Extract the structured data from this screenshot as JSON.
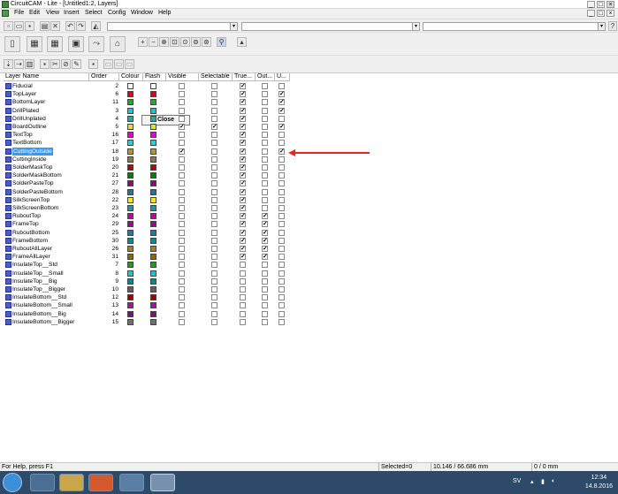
{
  "window": {
    "title": "CircuitCAM - Lite - [Untitled1:2, Layers]",
    "min": "_",
    "max": "□",
    "close": "×",
    "doc_min": "_",
    "doc_max": "□",
    "doc_close": "×"
  },
  "menu": [
    "File",
    "Edit",
    "View",
    "Insert",
    "Select",
    "Config",
    "Window",
    "Help"
  ],
  "toolbar": {
    "unit_value": "mm",
    "close_label": "Close",
    "help_icon": "?"
  },
  "columns": [
    "Layer Name",
    "Order",
    "Colour",
    "Flash",
    "Visible",
    "Selectable",
    "True...",
    "Out...",
    "U..."
  ],
  "layers": [
    {
      "name": "Fiducial",
      "order": "2",
      "colour": "#ffffff",
      "flash": "#ffffff",
      "visible": false,
      "selectable": false,
      "true": true,
      "out": false,
      "u": false
    },
    {
      "name": "TopLayer",
      "order": "6",
      "colour": "#e0001a",
      "flash": "#e0001a",
      "visible": false,
      "selectable": false,
      "true": true,
      "out": false,
      "u": true
    },
    {
      "name": "BottomLayer",
      "order": "11",
      "colour": "#00c000",
      "flash": "#00c000",
      "visible": false,
      "selectable": false,
      "true": true,
      "out": false,
      "u": true
    },
    {
      "name": "DrillPlated",
      "order": "3",
      "colour": "#00d0d0",
      "flash": "#00d0d0",
      "visible": false,
      "selectable": false,
      "true": true,
      "out": false,
      "u": true
    },
    {
      "name": "DrillUnplated",
      "order": "4",
      "colour": "#2aa8a0",
      "flash": "#2aa8a0",
      "visible": false,
      "selectable": false,
      "true": true,
      "out": false,
      "u": false
    },
    {
      "name": "BoardOutline",
      "order": "5",
      "colour": "#e6e600",
      "flash": "#e6e600",
      "visible": true,
      "selectable": true,
      "true": true,
      "out": false,
      "u": true
    },
    {
      "name": "TextTop",
      "order": "16",
      "colour": "#e000e0",
      "flash": "#e000e0",
      "visible": false,
      "selectable": false,
      "true": true,
      "out": false,
      "u": false
    },
    {
      "name": "TextBottom",
      "order": "17",
      "colour": "#00e0e0",
      "flash": "#00e0e0",
      "visible": false,
      "selectable": false,
      "true": true,
      "out": false,
      "u": false
    },
    {
      "name": "CuttingOutside",
      "order": "18",
      "colour": "#b0a000",
      "flash": "#b0a000",
      "visible": true,
      "selectable": false,
      "true": true,
      "out": false,
      "u": true,
      "selected": true
    },
    {
      "name": "CuttingInside",
      "order": "19",
      "colour": "#8a7a50",
      "flash": "#8a7a50",
      "visible": false,
      "selectable": false,
      "true": true,
      "out": false,
      "u": false
    },
    {
      "name": "SolderMaskTop",
      "order": "20",
      "colour": "#c00000",
      "flash": "#c00000",
      "visible": false,
      "selectable": false,
      "true": true,
      "out": false,
      "u": false
    },
    {
      "name": "SolderMaskBottom",
      "order": "21",
      "colour": "#008000",
      "flash": "#008000",
      "visible": false,
      "selectable": false,
      "true": true,
      "out": false,
      "u": false
    },
    {
      "name": "SolderPasteTop",
      "order": "27",
      "colour": "#9a0080",
      "flash": "#9a0080",
      "visible": false,
      "selectable": false,
      "true": true,
      "out": false,
      "u": false
    },
    {
      "name": "SolderPasteBottom",
      "order": "28",
      "colour": "#008890",
      "flash": "#008890",
      "visible": false,
      "selectable": false,
      "true": true,
      "out": false,
      "u": false
    },
    {
      "name": "SilkScreenTop",
      "order": "22",
      "colour": "#f0f000",
      "flash": "#f0f000",
      "visible": false,
      "selectable": false,
      "true": true,
      "out": false,
      "u": false
    },
    {
      "name": "SilkScreenBottom",
      "order": "23",
      "colour": "#00a0c0",
      "flash": "#00a0c0",
      "visible": false,
      "selectable": false,
      "true": true,
      "out": false,
      "u": false
    },
    {
      "name": "RuboutTop",
      "order": "24",
      "colour": "#c000a0",
      "flash": "#c000a0",
      "visible": false,
      "selectable": false,
      "true": true,
      "out": true,
      "u": false
    },
    {
      "name": "FrameTop",
      "order": "29",
      "colour": "#a000a0",
      "flash": "#a000a0",
      "visible": false,
      "selectable": false,
      "true": true,
      "out": true,
      "u": false
    },
    {
      "name": "RuboutBottom",
      "order": "25",
      "colour": "#008aa0",
      "flash": "#008aa0",
      "visible": false,
      "selectable": false,
      "true": true,
      "out": true,
      "u": false
    },
    {
      "name": "FrameBottom",
      "order": "30",
      "colour": "#009090",
      "flash": "#009090",
      "visible": false,
      "selectable": false,
      "true": true,
      "out": true,
      "u": false
    },
    {
      "name": "RuboutAllLayer",
      "order": "26",
      "colour": "#a08800",
      "flash": "#a08800",
      "visible": false,
      "selectable": false,
      "true": true,
      "out": true,
      "u": false
    },
    {
      "name": "FrameAllLayer",
      "order": "31",
      "colour": "#807000",
      "flash": "#807000",
      "visible": false,
      "selectable": false,
      "true": true,
      "out": true,
      "u": false
    },
    {
      "name": "InsulateTop__Std",
      "order": "7",
      "colour": "#00b000",
      "flash": "#00b000",
      "visible": false,
      "selectable": false,
      "false_true": true,
      "true": false,
      "out": false,
      "u": false
    },
    {
      "name": "InsulateTop__Small",
      "order": "8",
      "colour": "#00d0d0",
      "flash": "#00d0d0",
      "visible": false,
      "selectable": false,
      "true": false,
      "out": false,
      "u": false
    },
    {
      "name": "InsulateTop__Big",
      "order": "9",
      "colour": "#008a8a",
      "flash": "#008a8a",
      "visible": false,
      "selectable": false,
      "true": false,
      "out": false,
      "u": false
    },
    {
      "name": "InsulateTop__Bigger",
      "order": "10",
      "colour": "#606060",
      "flash": "#606060",
      "visible": false,
      "selectable": false,
      "true": false,
      "out": false,
      "u": false
    },
    {
      "name": "InsulateBottom__Std",
      "order": "12",
      "colour": "#a00000",
      "flash": "#a00000",
      "visible": false,
      "selectable": false,
      "true": false,
      "out": false,
      "u": false
    },
    {
      "name": "InsulateBottom__Small",
      "order": "13",
      "colour": "#c000c0",
      "flash": "#c000c0",
      "visible": false,
      "selectable": false,
      "true": false,
      "out": false,
      "u": false
    },
    {
      "name": "InsulateBottom__Big",
      "order": "14",
      "colour": "#900090",
      "flash": "#900090",
      "visible": false,
      "selectable": false,
      "true": false,
      "out": false,
      "u": false
    },
    {
      "name": "InsulateBottom__Bigger",
      "order": "15",
      "colour": "#707070",
      "flash": "#707070",
      "visible": false,
      "selectable": false,
      "true": false,
      "out": false,
      "u": false
    }
  ],
  "status": {
    "help": "For Help, press F1",
    "selected": "Selected=0",
    "coords": "10.146 / 66.686 mm",
    "delta": "0 / 0 mm"
  },
  "taskbar": {
    "lang": "SV",
    "time": "12:34",
    "date": "14.8.2016"
  },
  "colors": {
    "annotation_arrow": "#e8261b",
    "selection": "#3399ff",
    "taskbar": "#2d4a69"
  }
}
